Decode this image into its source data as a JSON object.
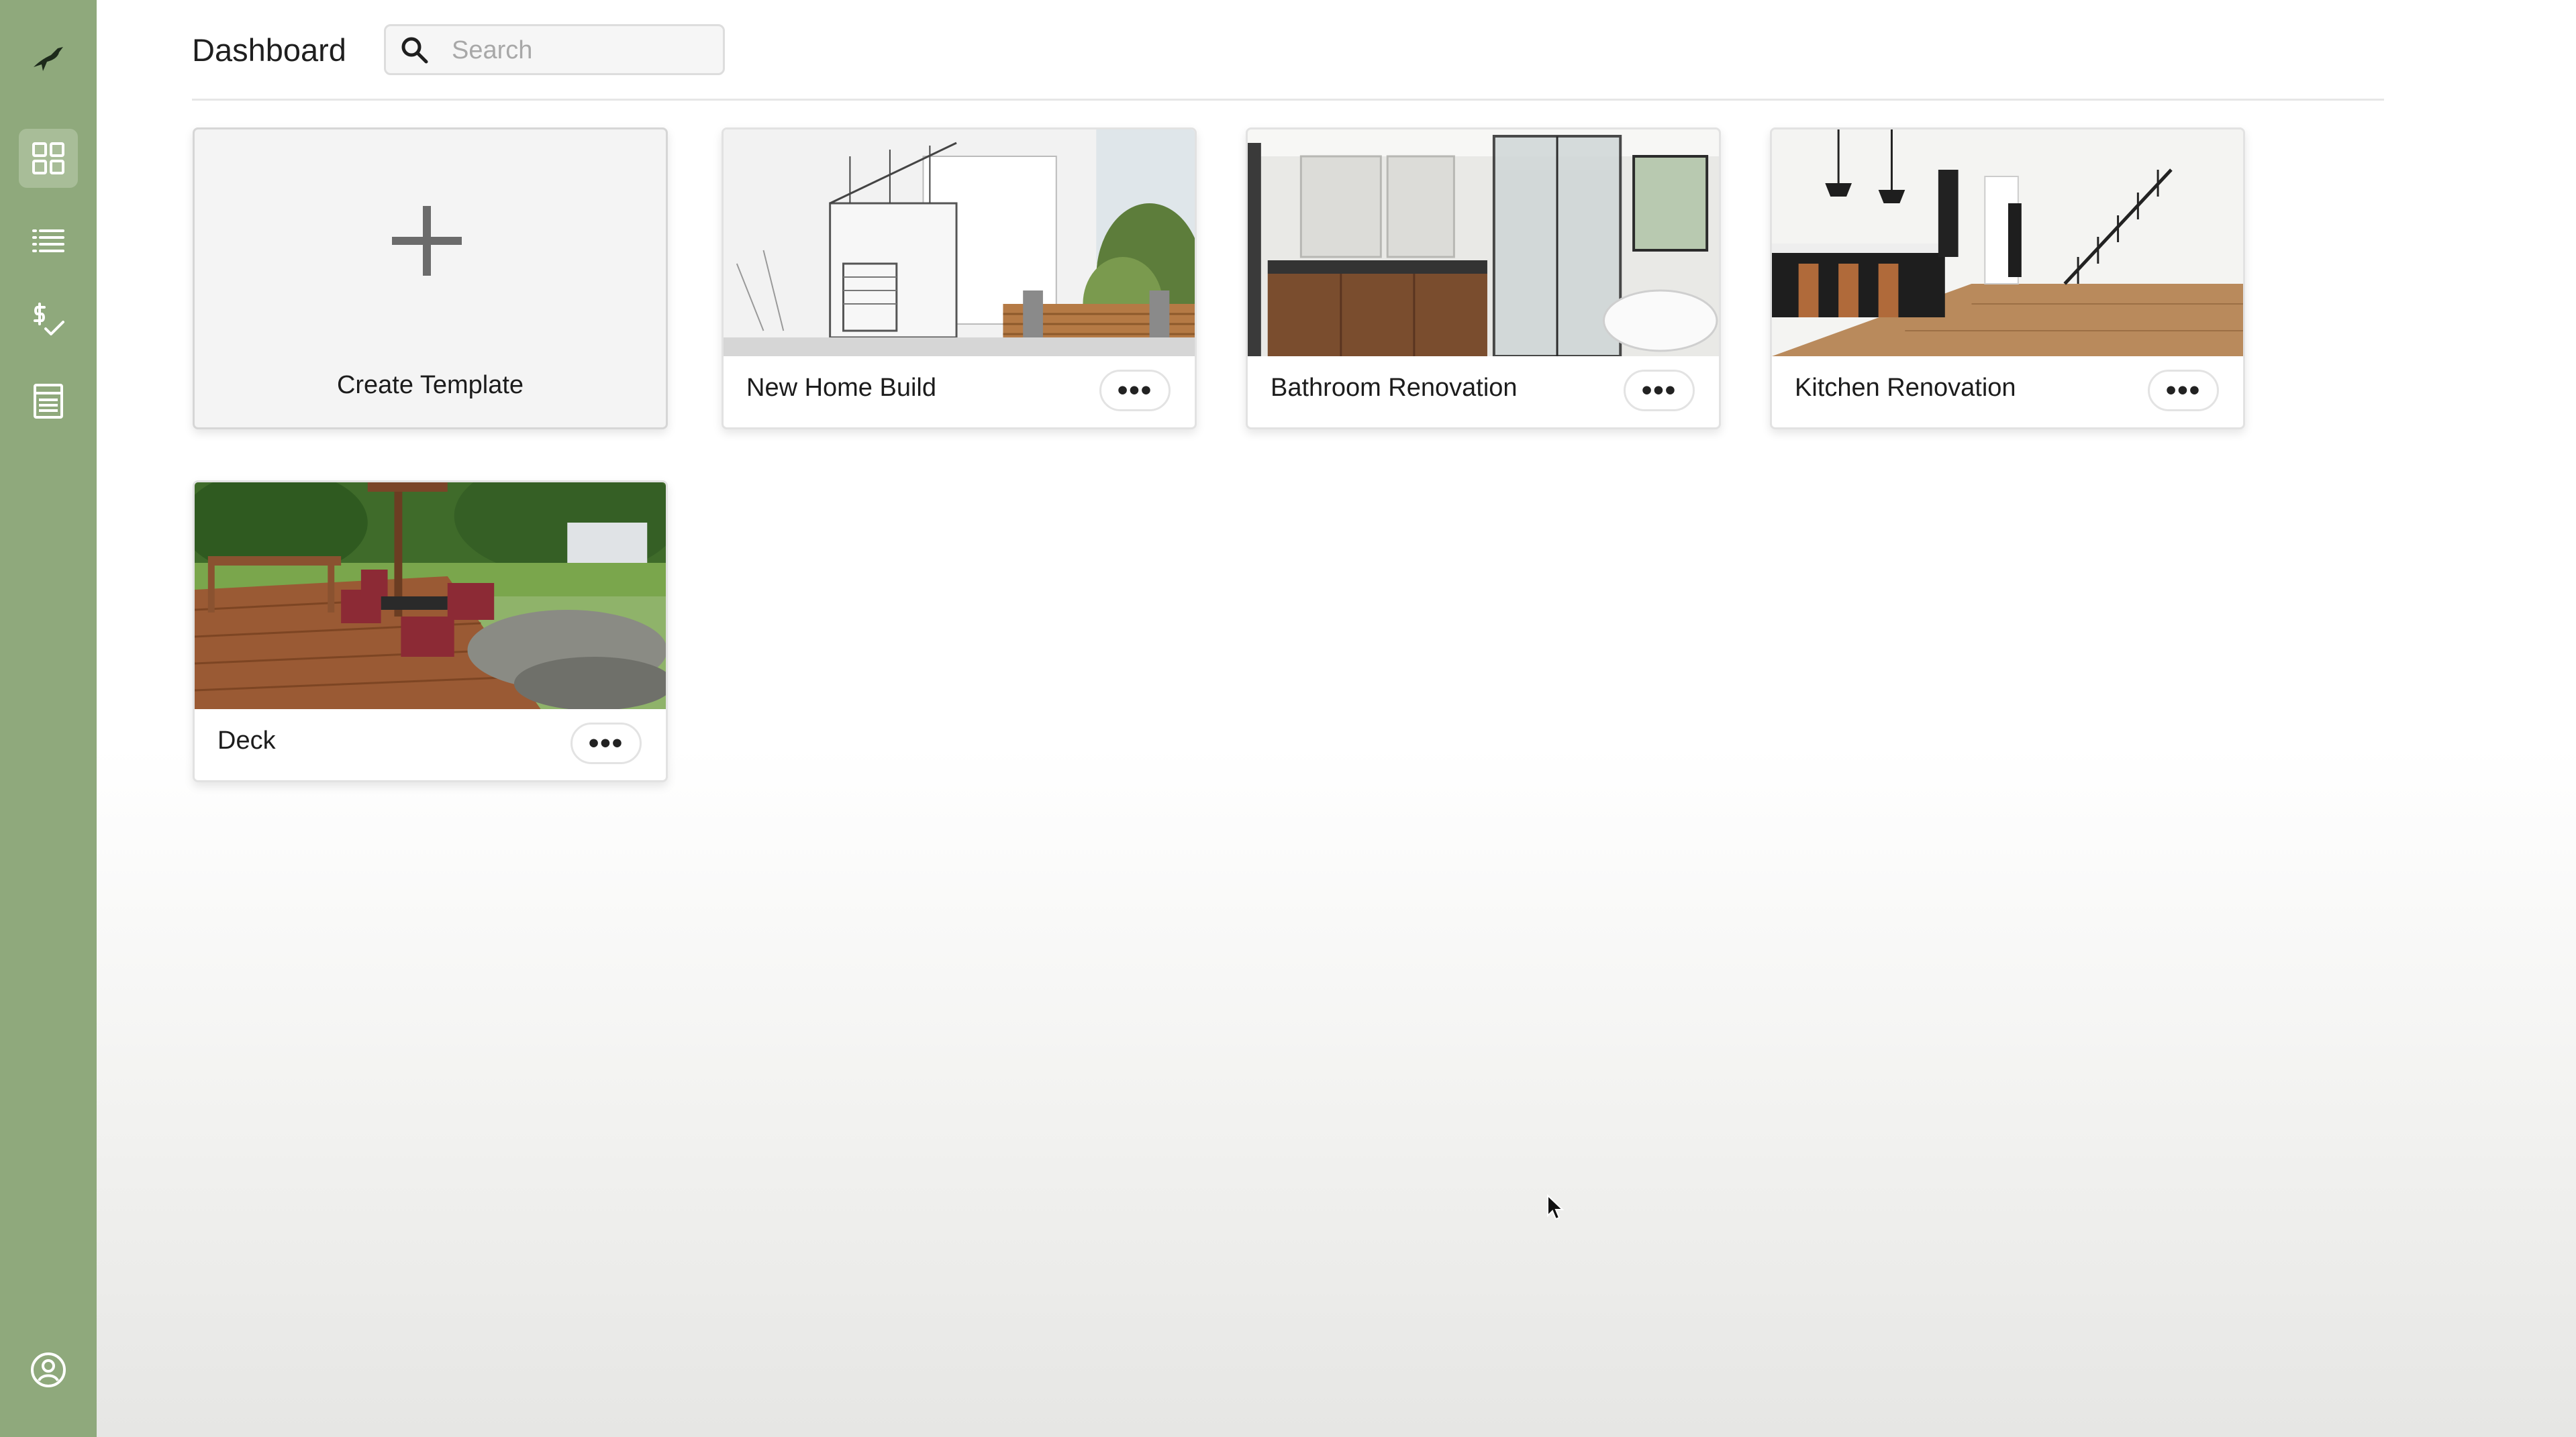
{
  "header": {
    "title": "Dashboard",
    "search_placeholder": "Search"
  },
  "sidebar": {
    "items": [
      {
        "icon": "bird-logo-icon"
      },
      {
        "icon": "grid-dashboard-icon",
        "active": true
      },
      {
        "icon": "list-icon"
      },
      {
        "icon": "dollar-check-icon"
      },
      {
        "icon": "document-icon"
      }
    ],
    "footer_icon": "user-circle-icon"
  },
  "cards": {
    "create": {
      "label": "Create Template"
    },
    "templates": [
      {
        "label": "New Home Build",
        "image": "house sketch rendering"
      },
      {
        "label": "Bathroom Renovation",
        "image": "modern bathroom"
      },
      {
        "label": "Kitchen Renovation",
        "image": "kitchen with staircase"
      },
      {
        "label": "Deck",
        "image": "backyard wooden deck"
      }
    ],
    "more_label": "•••"
  },
  "colors": {
    "sidebar": "#8fa97c",
    "sidebar_active": "#a8bd98"
  }
}
